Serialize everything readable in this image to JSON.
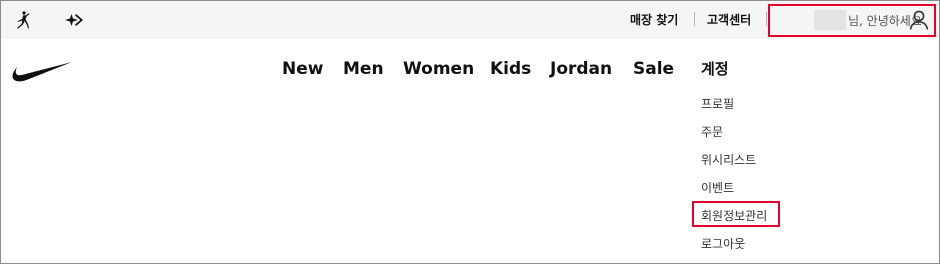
{
  "utility": {
    "find_store": "매장 찾기",
    "customer_center": "고객센터",
    "greeting": "님, 안녕하세요"
  },
  "nav": {
    "items": [
      "New",
      "Men",
      "Women",
      "Kids",
      "Jordan",
      "Sale"
    ]
  },
  "account_menu": {
    "title": "계정",
    "items": [
      "프로필",
      "주문",
      "위시리스트",
      "이벤트",
      "회원정보관리",
      "로그아웃"
    ]
  },
  "icons": {
    "jordan": "jumpman-icon",
    "converse": "converse-star-icon",
    "nike": "nike-swoosh-logo",
    "user": "user-icon"
  },
  "colors": {
    "highlight": "#e4002b",
    "utility_bar": "#f5f5f5"
  }
}
